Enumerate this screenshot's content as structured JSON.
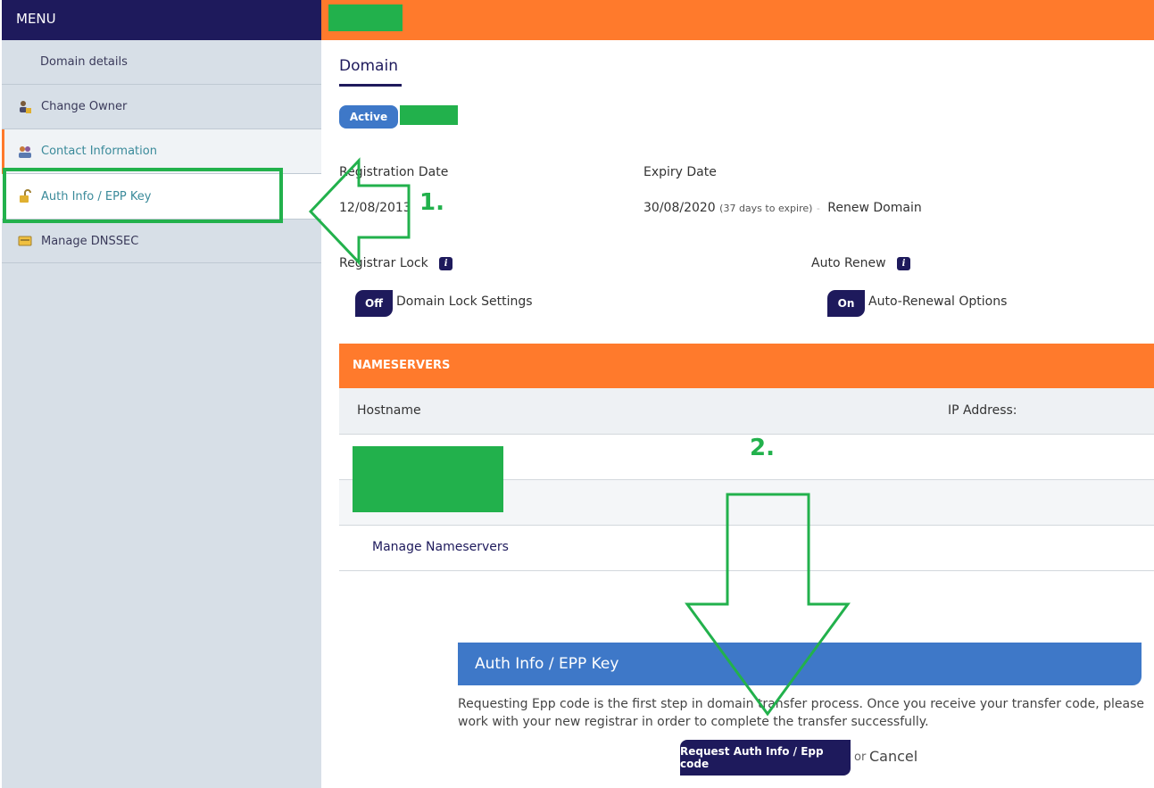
{
  "sidebar": {
    "menu_title": "MENU",
    "items": [
      {
        "label": "Domain details",
        "icon": ""
      },
      {
        "label": "Change Owner",
        "icon": "owner-icon"
      },
      {
        "label": "Contact Information",
        "icon": "contacts-icon"
      },
      {
        "label": "Auth Info / EPP Key",
        "icon": "lock-icon"
      },
      {
        "label": "Manage DNSSEC",
        "icon": "dnssec-card-icon"
      }
    ]
  },
  "main": {
    "tab_label": "Domain",
    "status": "Active",
    "registration": {
      "label": "Registration Date",
      "value": "12/08/2013"
    },
    "expiry": {
      "label": "Expiry Date",
      "value": "30/08/2020",
      "days_note": "(37 days to expire)",
      "renew_link": "Renew Domain"
    },
    "registrar_lock": {
      "label": "Registrar Lock",
      "toggle": "Off",
      "settings_link": "Domain Lock Settings"
    },
    "auto_renew": {
      "label": "Auto Renew",
      "toggle": "On",
      "options_link": "Auto-Renewal Options"
    },
    "info_glyph": "i"
  },
  "nameservers": {
    "title": "NAMESERVERS",
    "col_hostname": "Hostname",
    "col_ip": "IP Address:",
    "manage_link": "Manage Nameservers"
  },
  "auth_panel": {
    "title": "Auth Info / EPP Key",
    "description": "Requesting Epp code is the first step in domain transfer process. Once you receive your transfer code, please work with your new registrar in order to complete the transfer successfully.",
    "request_button": "Request Auth Info / Epp code",
    "or_text": "or",
    "cancel_link": "Cancel"
  },
  "annotations": {
    "step1": "1.",
    "step2": "2."
  },
  "colors": {
    "navy": "#1e1a5c",
    "orange": "#ff7a2c",
    "blue": "#3e78c8",
    "annotation_green": "#22b14c"
  }
}
